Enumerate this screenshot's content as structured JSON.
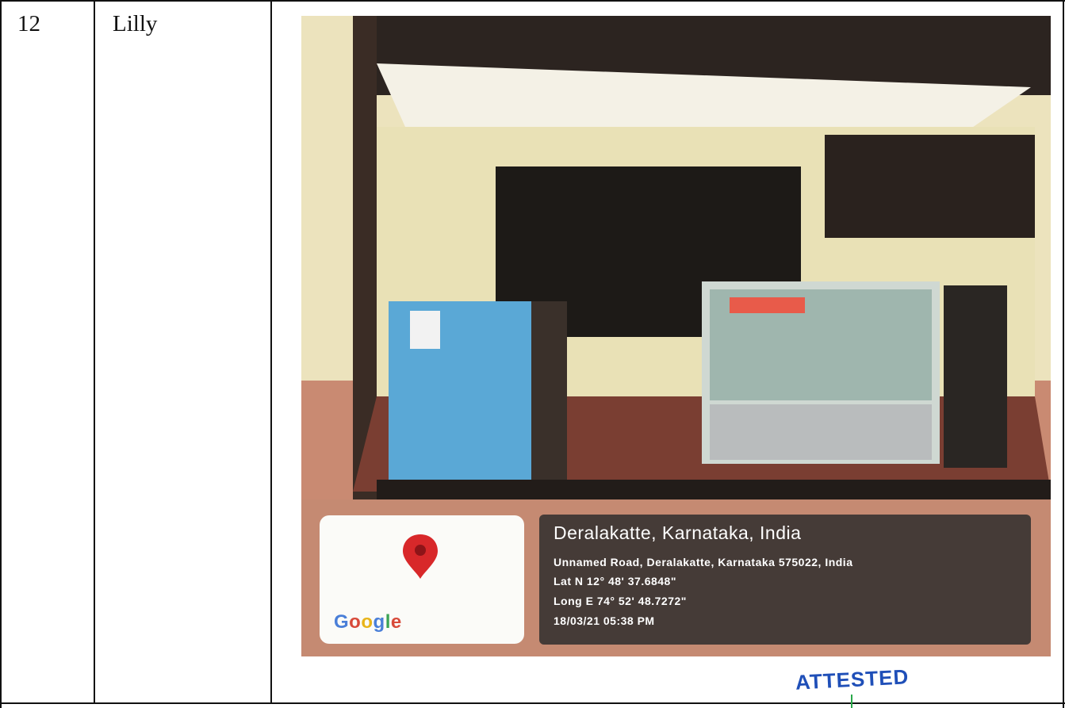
{
  "row": {
    "number": "12",
    "name": "Lilly"
  },
  "photo": {
    "description_icon": "shop-counter-photo",
    "overlay": {
      "place": "Deralakatte, Karnataka, India",
      "address": "Unnamed Road, Deralakatte, Karnataka 575022, India",
      "lat": "Lat N 12° 48' 37.6848\"",
      "long": "Long E 74° 52' 48.7272\"",
      "datetime": "18/03/21 05:38 PM"
    },
    "map": {
      "logo": "Google",
      "pin_icon": "map-pin-icon"
    }
  },
  "stamp": {
    "text": "ATTESTED"
  }
}
